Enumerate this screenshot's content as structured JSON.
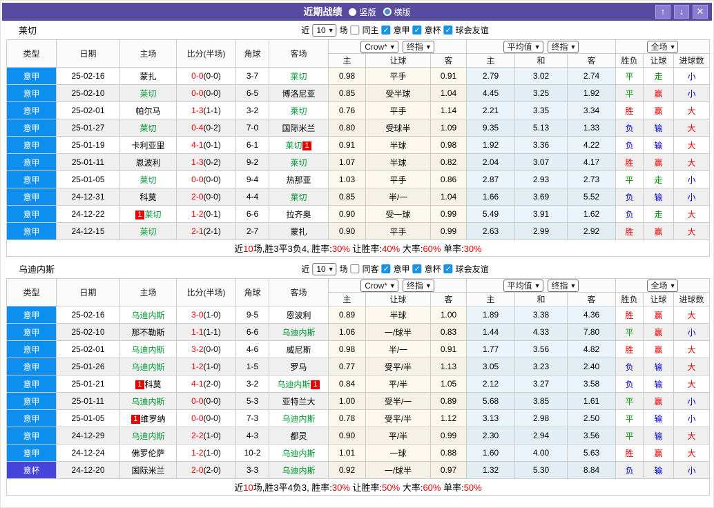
{
  "card_badge": "1",
  "colors": {
    "titlebar_purple": "#564b9f",
    "league_serie_a": "#0d8fef",
    "league_cup": "#4545dc",
    "team_green": "#009933",
    "score_red": "#e60000",
    "checkbox_blue": "#1793e8",
    "result_colors": {
      "胜": "#e60000",
      "平": "#009900",
      "负": "#0000dd",
      "赢": "#e60000",
      "走": "#009900",
      "输": "#0000dd",
      "大": "#e60000",
      "小": "#0000dd"
    }
  },
  "titlebar": {
    "title": "近期战绩",
    "portrait": "竖版",
    "landscape": "横版",
    "up": "↑",
    "down": "↓",
    "close": "✕"
  },
  "table_header": {
    "main": [
      "类型",
      "日期",
      "主场",
      "比分(半场)",
      "角球",
      "客场"
    ],
    "sub": [
      "主",
      "让球",
      "客",
      "主",
      "和",
      "客",
      "胜负",
      "让球",
      "进球数"
    ],
    "crow_select": "Crow*",
    "final_select_1": "终指",
    "avg_select": "平均值",
    "final_select_2": "终指",
    "scope_select": "全场"
  },
  "sections": [
    {
      "team": "莱切",
      "controls": {
        "near": "近",
        "count": "10",
        "games": "场",
        "same_label": "同主",
        "same_checked": false,
        "leagues": [
          "意甲",
          "意杯",
          "球会友谊"
        ]
      },
      "rows": [
        {
          "league": "意甲",
          "date": "25-02-16",
          "home": "蒙扎",
          "home_focus": false,
          "home_card": false,
          "score": "0-0",
          "half": "(0-0)",
          "corner": "3-7",
          "away": "莱切",
          "away_focus": true,
          "away_card": false,
          "crow_home": "0.98",
          "handicap": "平手",
          "crow_away": "0.91",
          "avg_home": "2.79",
          "avg_draw": "3.02",
          "avg_away": "2.74",
          "result": "平",
          "handicap_result": "走",
          "goals": "小"
        },
        {
          "league": "意甲",
          "date": "25-02-10",
          "home": "莱切",
          "home_focus": true,
          "home_card": false,
          "score": "0-0",
          "half": "(0-0)",
          "corner": "6-5",
          "away": "博洛尼亚",
          "away_focus": false,
          "away_card": false,
          "crow_home": "0.85",
          "handicap": "受半球",
          "crow_away": "1.04",
          "avg_home": "4.45",
          "avg_draw": "3.25",
          "avg_away": "1.92",
          "result": "平",
          "handicap_result": "赢",
          "goals": "小"
        },
        {
          "league": "意甲",
          "date": "25-02-01",
          "home": "帕尔马",
          "home_focus": false,
          "home_card": false,
          "score": "1-3",
          "half": "(1-1)",
          "corner": "3-2",
          "away": "莱切",
          "away_focus": true,
          "away_card": false,
          "crow_home": "0.76",
          "handicap": "平手",
          "crow_away": "1.14",
          "avg_home": "2.21",
          "avg_draw": "3.35",
          "avg_away": "3.34",
          "result": "胜",
          "handicap_result": "赢",
          "goals": "大"
        },
        {
          "league": "意甲",
          "date": "25-01-27",
          "home": "莱切",
          "home_focus": true,
          "home_card": false,
          "score": "0-4",
          "half": "(0-2)",
          "corner": "7-0",
          "away": "国际米兰",
          "away_focus": false,
          "away_card": false,
          "crow_home": "0.80",
          "handicap": "受球半",
          "crow_away": "1.09",
          "avg_home": "9.35",
          "avg_draw": "5.13",
          "avg_away": "1.33",
          "result": "负",
          "handicap_result": "输",
          "goals": "大"
        },
        {
          "league": "意甲",
          "date": "25-01-19",
          "home": "卡利亚里",
          "home_focus": false,
          "home_card": false,
          "score": "4-1",
          "half": "(0-1)",
          "corner": "6-1",
          "away": "莱切",
          "away_focus": true,
          "away_card": true,
          "crow_home": "0.91",
          "handicap": "半球",
          "crow_away": "0.98",
          "avg_home": "1.92",
          "avg_draw": "3.36",
          "avg_away": "4.22",
          "result": "负",
          "handicap_result": "输",
          "goals": "大"
        },
        {
          "league": "意甲",
          "date": "25-01-11",
          "home": "恩波利",
          "home_focus": false,
          "home_card": false,
          "score": "1-3",
          "half": "(0-2)",
          "corner": "9-2",
          "away": "莱切",
          "away_focus": true,
          "away_card": false,
          "crow_home": "1.07",
          "handicap": "半球",
          "crow_away": "0.82",
          "avg_home": "2.04",
          "avg_draw": "3.07",
          "avg_away": "4.17",
          "result": "胜",
          "handicap_result": "赢",
          "goals": "大"
        },
        {
          "league": "意甲",
          "date": "25-01-05",
          "home": "莱切",
          "home_focus": true,
          "home_card": false,
          "score": "0-0",
          "half": "(0-0)",
          "corner": "9-4",
          "away": "热那亚",
          "away_focus": false,
          "away_card": false,
          "crow_home": "1.03",
          "handicap": "平手",
          "crow_away": "0.86",
          "avg_home": "2.87",
          "avg_draw": "2.93",
          "avg_away": "2.73",
          "result": "平",
          "handicap_result": "走",
          "goals": "小"
        },
        {
          "league": "意甲",
          "date": "24-12-31",
          "home": "科莫",
          "home_focus": false,
          "home_card": false,
          "score": "2-0",
          "half": "(0-0)",
          "corner": "4-4",
          "away": "莱切",
          "away_focus": true,
          "away_card": false,
          "crow_home": "0.85",
          "handicap": "半/一",
          "crow_away": "1.04",
          "avg_home": "1.66",
          "avg_draw": "3.69",
          "avg_away": "5.52",
          "result": "负",
          "handicap_result": "输",
          "goals": "小"
        },
        {
          "league": "意甲",
          "date": "24-12-22",
          "home": "莱切",
          "home_focus": true,
          "home_card": true,
          "score": "1-2",
          "half": "(0-1)",
          "corner": "6-6",
          "away": "拉齐奥",
          "away_focus": false,
          "away_card": false,
          "crow_home": "0.90",
          "handicap": "受一球",
          "crow_away": "0.99",
          "avg_home": "5.49",
          "avg_draw": "3.91",
          "avg_away": "1.62",
          "result": "负",
          "handicap_result": "走",
          "goals": "大"
        },
        {
          "league": "意甲",
          "date": "24-12-15",
          "home": "莱切",
          "home_focus": true,
          "home_card": false,
          "score": "2-1",
          "half": "(2-1)",
          "corner": "2-7",
          "away": "蒙扎",
          "away_focus": false,
          "away_card": false,
          "crow_home": "0.90",
          "handicap": "平手",
          "crow_away": "0.99",
          "avg_home": "2.63",
          "avg_draw": "2.99",
          "avg_away": "2.92",
          "result": "胜",
          "handicap_result": "赢",
          "goals": "大"
        }
      ],
      "summary": [
        {
          "t": "近",
          "red": false
        },
        {
          "t": "10",
          "red": true
        },
        {
          "t": "场,胜3平3负4, 胜率:",
          "red": false
        },
        {
          "t": "30%",
          "red": true
        },
        {
          "t": " 让胜率:",
          "red": false
        },
        {
          "t": "40%",
          "red": true
        },
        {
          "t": " 大率:",
          "red": false
        },
        {
          "t": "60%",
          "red": true
        },
        {
          "t": " 单率:",
          "red": false
        },
        {
          "t": "30%",
          "red": true
        }
      ]
    },
    {
      "team": "乌迪内斯",
      "controls": {
        "near": "近",
        "count": "10",
        "games": "场",
        "same_label": "同客",
        "same_checked": false,
        "leagues": [
          "意甲",
          "意杯",
          "球会友谊"
        ]
      },
      "rows": [
        {
          "league": "意甲",
          "date": "25-02-16",
          "home": "乌迪内斯",
          "home_focus": true,
          "home_card": false,
          "score": "3-0",
          "half": "(1-0)",
          "corner": "9-5",
          "away": "恩波利",
          "away_focus": false,
          "away_card": false,
          "crow_home": "0.89",
          "handicap": "半球",
          "crow_away": "1.00",
          "avg_home": "1.89",
          "avg_draw": "3.38",
          "avg_away": "4.36",
          "result": "胜",
          "handicap_result": "赢",
          "goals": "大"
        },
        {
          "league": "意甲",
          "date": "25-02-10",
          "home": "那不勒斯",
          "home_focus": false,
          "home_card": false,
          "score": "1-1",
          "half": "(1-1)",
          "corner": "6-6",
          "away": "乌迪内斯",
          "away_focus": true,
          "away_card": false,
          "crow_home": "1.06",
          "handicap": "一/球半",
          "crow_away": "0.83",
          "avg_home": "1.44",
          "avg_draw": "4.33",
          "avg_away": "7.80",
          "result": "平",
          "handicap_result": "赢",
          "goals": "小"
        },
        {
          "league": "意甲",
          "date": "25-02-01",
          "home": "乌迪内斯",
          "home_focus": true,
          "home_card": false,
          "score": "3-2",
          "half": "(0-0)",
          "corner": "4-6",
          "away": "威尼斯",
          "away_focus": false,
          "away_card": false,
          "crow_home": "0.98",
          "handicap": "半/一",
          "crow_away": "0.91",
          "avg_home": "1.77",
          "avg_draw": "3.56",
          "avg_away": "4.82",
          "result": "胜",
          "handicap_result": "赢",
          "goals": "大"
        },
        {
          "league": "意甲",
          "date": "25-01-26",
          "home": "乌迪内斯",
          "home_focus": true,
          "home_card": false,
          "score": "1-2",
          "half": "(1-0)",
          "corner": "1-5",
          "away": "罗马",
          "away_focus": false,
          "away_card": false,
          "crow_home": "0.77",
          "handicap": "受平/半",
          "crow_away": "1.13",
          "avg_home": "3.05",
          "avg_draw": "3.23",
          "avg_away": "2.40",
          "result": "负",
          "handicap_result": "输",
          "goals": "大"
        },
        {
          "league": "意甲",
          "date": "25-01-21",
          "home": "科莫",
          "home_focus": false,
          "home_card": true,
          "score": "4-1",
          "half": "(2-0)",
          "corner": "3-2",
          "away": "乌迪内斯",
          "away_focus": true,
          "away_card": true,
          "crow_home": "0.84",
          "handicap": "平/半",
          "crow_away": "1.05",
          "avg_home": "2.12",
          "avg_draw": "3.27",
          "avg_away": "3.58",
          "result": "负",
          "handicap_result": "输",
          "goals": "大"
        },
        {
          "league": "意甲",
          "date": "25-01-11",
          "home": "乌迪内斯",
          "home_focus": true,
          "home_card": false,
          "score": "0-0",
          "half": "(0-0)",
          "corner": "5-3",
          "away": "亚特兰大",
          "away_focus": false,
          "away_card": false,
          "crow_home": "1.00",
          "handicap": "受半/一",
          "crow_away": "0.89",
          "avg_home": "5.68",
          "avg_draw": "3.85",
          "avg_away": "1.61",
          "result": "平",
          "handicap_result": "赢",
          "goals": "小"
        },
        {
          "league": "意甲",
          "date": "25-01-05",
          "home": "维罗纳",
          "home_focus": false,
          "home_card": true,
          "score": "0-0",
          "half": "(0-0)",
          "corner": "7-3",
          "away": "乌迪内斯",
          "away_focus": true,
          "away_card": false,
          "crow_home": "0.78",
          "handicap": "受平/半",
          "crow_away": "1.12",
          "avg_home": "3.13",
          "avg_draw": "2.98",
          "avg_away": "2.50",
          "result": "平",
          "handicap_result": "输",
          "goals": "小"
        },
        {
          "league": "意甲",
          "date": "24-12-29",
          "home": "乌迪内斯",
          "home_focus": true,
          "home_card": false,
          "score": "2-2",
          "half": "(1-0)",
          "corner": "4-3",
          "away": "都灵",
          "away_focus": false,
          "away_card": false,
          "crow_home": "0.90",
          "handicap": "平/半",
          "crow_away": "0.99",
          "avg_home": "2.30",
          "avg_draw": "2.94",
          "avg_away": "3.56",
          "result": "平",
          "handicap_result": "输",
          "goals": "大"
        },
        {
          "league": "意甲",
          "date": "24-12-24",
          "home": "佛罗伦萨",
          "home_focus": false,
          "home_card": false,
          "score": "1-2",
          "half": "(1-0)",
          "corner": "10-2",
          "away": "乌迪内斯",
          "away_focus": true,
          "away_card": false,
          "crow_home": "1.01",
          "handicap": "一球",
          "crow_away": "0.88",
          "avg_home": "1.60",
          "avg_draw": "4.00",
          "avg_away": "5.63",
          "result": "胜",
          "handicap_result": "赢",
          "goals": "大"
        },
        {
          "league": "意杯",
          "date": "24-12-20",
          "home": "国际米兰",
          "home_focus": false,
          "home_card": false,
          "score": "2-0",
          "half": "(2-0)",
          "corner": "3-3",
          "away": "乌迪内斯",
          "away_focus": true,
          "away_card": false,
          "crow_home": "0.92",
          "handicap": "一/球半",
          "crow_away": "0.97",
          "avg_home": "1.32",
          "avg_draw": "5.30",
          "avg_away": "8.84",
          "result": "负",
          "handicap_result": "输",
          "goals": "小"
        }
      ],
      "summary": [
        {
          "t": "近",
          "red": false
        },
        {
          "t": "10",
          "red": true
        },
        {
          "t": "场,胜3平4负3, 胜率:",
          "red": false
        },
        {
          "t": "30%",
          "red": true
        },
        {
          "t": " 让胜率:",
          "red": false
        },
        {
          "t": "50%",
          "red": true
        },
        {
          "t": " 大率:",
          "red": false
        },
        {
          "t": "60%",
          "red": true
        },
        {
          "t": " 单率:",
          "red": false
        },
        {
          "t": "50%",
          "red": true
        }
      ]
    }
  ]
}
